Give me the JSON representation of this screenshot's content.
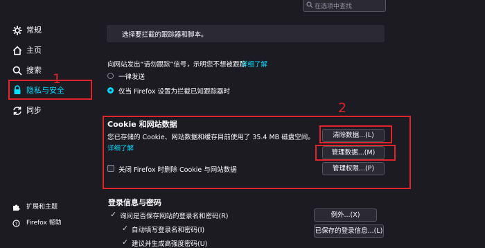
{
  "search": {
    "placeholder": "在选项中查找"
  },
  "sidebar": {
    "items": [
      {
        "label": "常规",
        "icon": "gear-icon"
      },
      {
        "label": "主页",
        "icon": "home-icon"
      },
      {
        "label": "搜索",
        "icon": "search-icon"
      },
      {
        "label": "隐私与安全",
        "icon": "lock-icon",
        "selected": true
      },
      {
        "label": "同步",
        "icon": "sync-icon"
      }
    ],
    "footer": [
      {
        "label": "扩展和主题",
        "icon": "puzzle-icon"
      },
      {
        "label": "Firefox 帮助",
        "icon": "help-icon"
      }
    ]
  },
  "tracking": {
    "custom_block_text": "选择要拦截的跟踪器和脚本。",
    "dnt_text": "向网站发出“请勿跟踪”信号，示明您不想被跟踪",
    "dnt_link": "详细了解",
    "option_always": "一律发送",
    "option_only_when": "仅当 Firefox 设置为拦截已知跟踪器时"
  },
  "cookies": {
    "heading": "Cookie 和网站数据",
    "description": "您已存储的 Cookie、网站数据和缓存目前使用了 35.4 MB 磁盘空间。",
    "learn_more": "详细了解",
    "clear_button": "清除数据...(L)",
    "manage_button": "管理数据...(M)",
    "permissions_button": "管理权限...(P)",
    "delete_on_close": "关闭 Firefox 时删除 Cookie 与网站数据",
    "delete_on_close_checked": false
  },
  "logins": {
    "heading": "登录信息与密码",
    "ask_to_save": "询问是否保存网站的登录名和密码(R)",
    "autofill": "自动填写登录名和密码(I)",
    "suggest": "建议并生成高强度密码(U)",
    "exceptions_button": "例外...(X)",
    "saved_logins_button": "已保存的登录信息...(L)"
  },
  "annotations": {
    "marker_1": "1",
    "marker_2": "2",
    "color": "#e0242b"
  },
  "colors": {
    "background": "#1c1b22",
    "accent": "#00ddff",
    "text": "#fbfbfe"
  }
}
